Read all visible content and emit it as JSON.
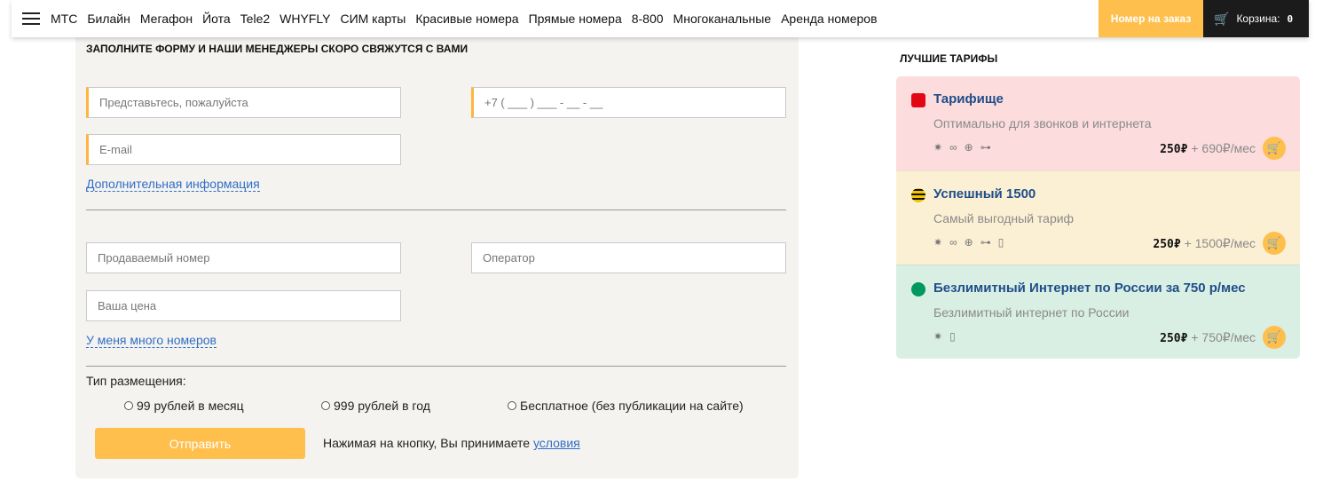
{
  "nav": {
    "items": [
      "МТС",
      "Билайн",
      "Мегафон",
      "Йота",
      "Tele2",
      "WHYFLY",
      "СИМ карты",
      "Красивые номера",
      "Прямые номера",
      "8-800",
      "Многоканальные",
      "Аренда номеров"
    ],
    "order_button": "Номер на заказ",
    "cart_label": "Корзина:",
    "cart_count": "0"
  },
  "form": {
    "title": "ЗАПОЛНИТЕ ФОРМУ И НАШИ МЕНЕДЖЕРЫ СКОРО СВЯЖУТСЯ С ВАМИ",
    "name_placeholder": "Представьтесь, пожалуйста",
    "phone_placeholder": "+7 ( ___ ) ___ - __ - __",
    "email_placeholder": "E-mail",
    "additional_info_link": "Дополнительная информация",
    "sold_number_placeholder": "Продаваемый номер",
    "operator_placeholder": "Оператор",
    "price_placeholder": "Ваша цена",
    "many_numbers_link": "У меня много номеров",
    "placement_label": "Тип размещения:",
    "placement_options": [
      "99 рублей в месяц",
      "999 рублей в год",
      "Бесплатное (без публикации на сайте)"
    ],
    "submit_label": "Отправить",
    "agree_text": "Нажимая на кнопку, Вы принимаете",
    "terms_link": "условия"
  },
  "tariffs": {
    "title": "ЛУЧШИЕ ТАРИФЫ",
    "items": [
      {
        "name": "Тарифище",
        "description": "Оптимально для звонков и интернета",
        "price": "250₽",
        "monthly": "+ 690₽/мес",
        "bg": "#fcdcdc",
        "logo_color": "#e30613",
        "features": [
          "✷",
          "∞",
          "⊕",
          "⊶"
        ]
      },
      {
        "name": "Успешный 1500",
        "description": "Самый выгодный тариф",
        "price": "250₽",
        "monthly": "+ 1500₽/мес",
        "bg": "#fcf0d4",
        "logo_color": "#f5c400",
        "features": [
          "✷",
          "∞",
          "⊕",
          "⊶",
          "▯"
        ]
      },
      {
        "name": "Безлимитный Интернет по России за 750 р/мес",
        "description": "Безлимитный интернет по России",
        "price": "250₽",
        "monthly": "+ 750₽/мес",
        "bg": "#d9efe3",
        "logo_color": "#00985f",
        "features": [
          "✷",
          "▯"
        ]
      }
    ]
  }
}
